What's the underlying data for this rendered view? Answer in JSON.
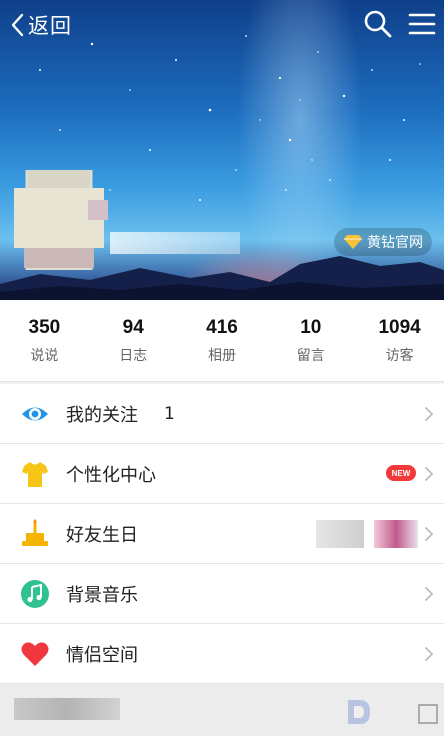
{
  "topbar": {
    "back_label": "返回",
    "back_icon": "chevron-left-icon",
    "search_icon": "search-icon",
    "menu_icon": "hamburger-menu-icon"
  },
  "cover": {
    "vip_badge_label": "黄钻官网",
    "vip_badge_icon": "diamond-icon",
    "accent_color": "#f6c23a"
  },
  "stats": [
    {
      "num": "350",
      "label": "说说"
    },
    {
      "num": "94",
      "label": "日志"
    },
    {
      "num": "416",
      "label": "相册"
    },
    {
      "num": "10",
      "label": "留言"
    },
    {
      "num": "1094",
      "label": "访客"
    }
  ],
  "menu": [
    {
      "label": "我的关注",
      "count": "1",
      "icon": "eye-icon",
      "icon_color": "#2196e8"
    },
    {
      "label": "个性化中心",
      "icon": "tshirt-icon",
      "icon_color": "#f5c518",
      "badge": "NEW",
      "badge_color": "#f23a3a"
    },
    {
      "label": "好友生日",
      "icon": "birthday-cake-icon",
      "icon_color": "#f5b400"
    },
    {
      "label": "背景音乐",
      "icon": "music-note-icon",
      "icon_color": "#2fc28e"
    },
    {
      "label": "情侣空间",
      "icon": "heart-icon",
      "icon_color": "#f0373d"
    }
  ]
}
